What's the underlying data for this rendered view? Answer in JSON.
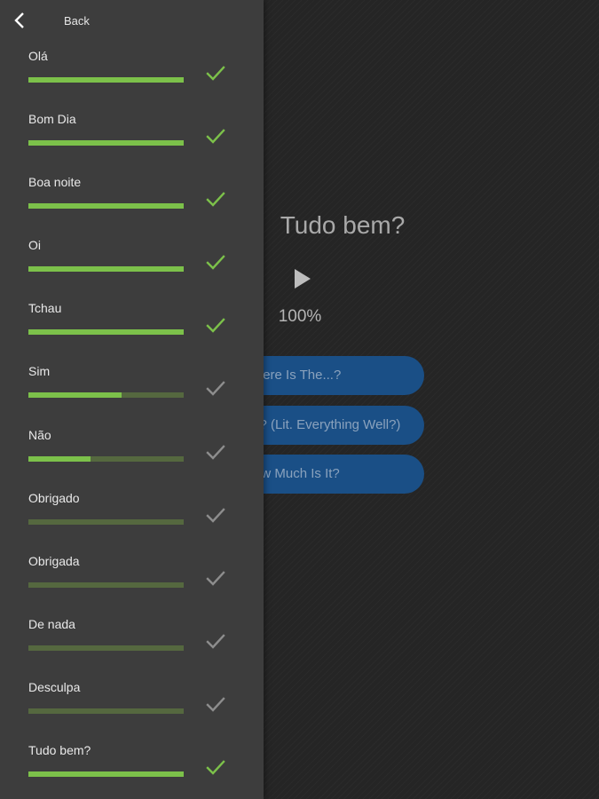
{
  "colors": {
    "accent_green": "#7cc14a",
    "track_green": "#55683f",
    "check_gray": "#8d8d8d",
    "answer_blue": "#1a4f86",
    "drawer_bg": "#3d3d3d",
    "page_bg": "#252525"
  },
  "drawer": {
    "back_icon": "chevron-left-icon",
    "back_label": "Back",
    "items": [
      {
        "label": "Olá",
        "progress": 1.0,
        "completed": true,
        "icon": "check-icon"
      },
      {
        "label": "Bom Dia",
        "progress": 1.0,
        "completed": true,
        "icon": "check-icon"
      },
      {
        "label": "Boa noite",
        "progress": 1.0,
        "completed": true,
        "icon": "check-icon"
      },
      {
        "label": "Oi",
        "progress": 1.0,
        "completed": true,
        "icon": "check-icon"
      },
      {
        "label": "Tchau",
        "progress": 1.0,
        "completed": true,
        "icon": "check-icon"
      },
      {
        "label": "Sim",
        "progress": 0.6,
        "completed": false,
        "icon": "check-icon"
      },
      {
        "label": "Não",
        "progress": 0.4,
        "completed": false,
        "icon": "check-icon"
      },
      {
        "label": "Obrigado",
        "progress": 0.0,
        "completed": false,
        "icon": "check-icon"
      },
      {
        "label": "Obrigada",
        "progress": 0.0,
        "completed": false,
        "icon": "check-icon"
      },
      {
        "label": "De nada",
        "progress": 0.0,
        "completed": false,
        "icon": "check-icon"
      },
      {
        "label": "Desculpa",
        "progress": 0.0,
        "completed": false,
        "icon": "check-icon"
      },
      {
        "label": "Tudo bem?",
        "progress": 1.0,
        "completed": true,
        "icon": "check-icon"
      }
    ]
  },
  "main": {
    "phrase": "Tudo bem?",
    "play_icon": "play-icon",
    "progress_text": "100%",
    "answers": [
      "Where Is The...?",
      "How Are You? (Lit. Everything Well?)",
      "How Much Is It?"
    ]
  }
}
